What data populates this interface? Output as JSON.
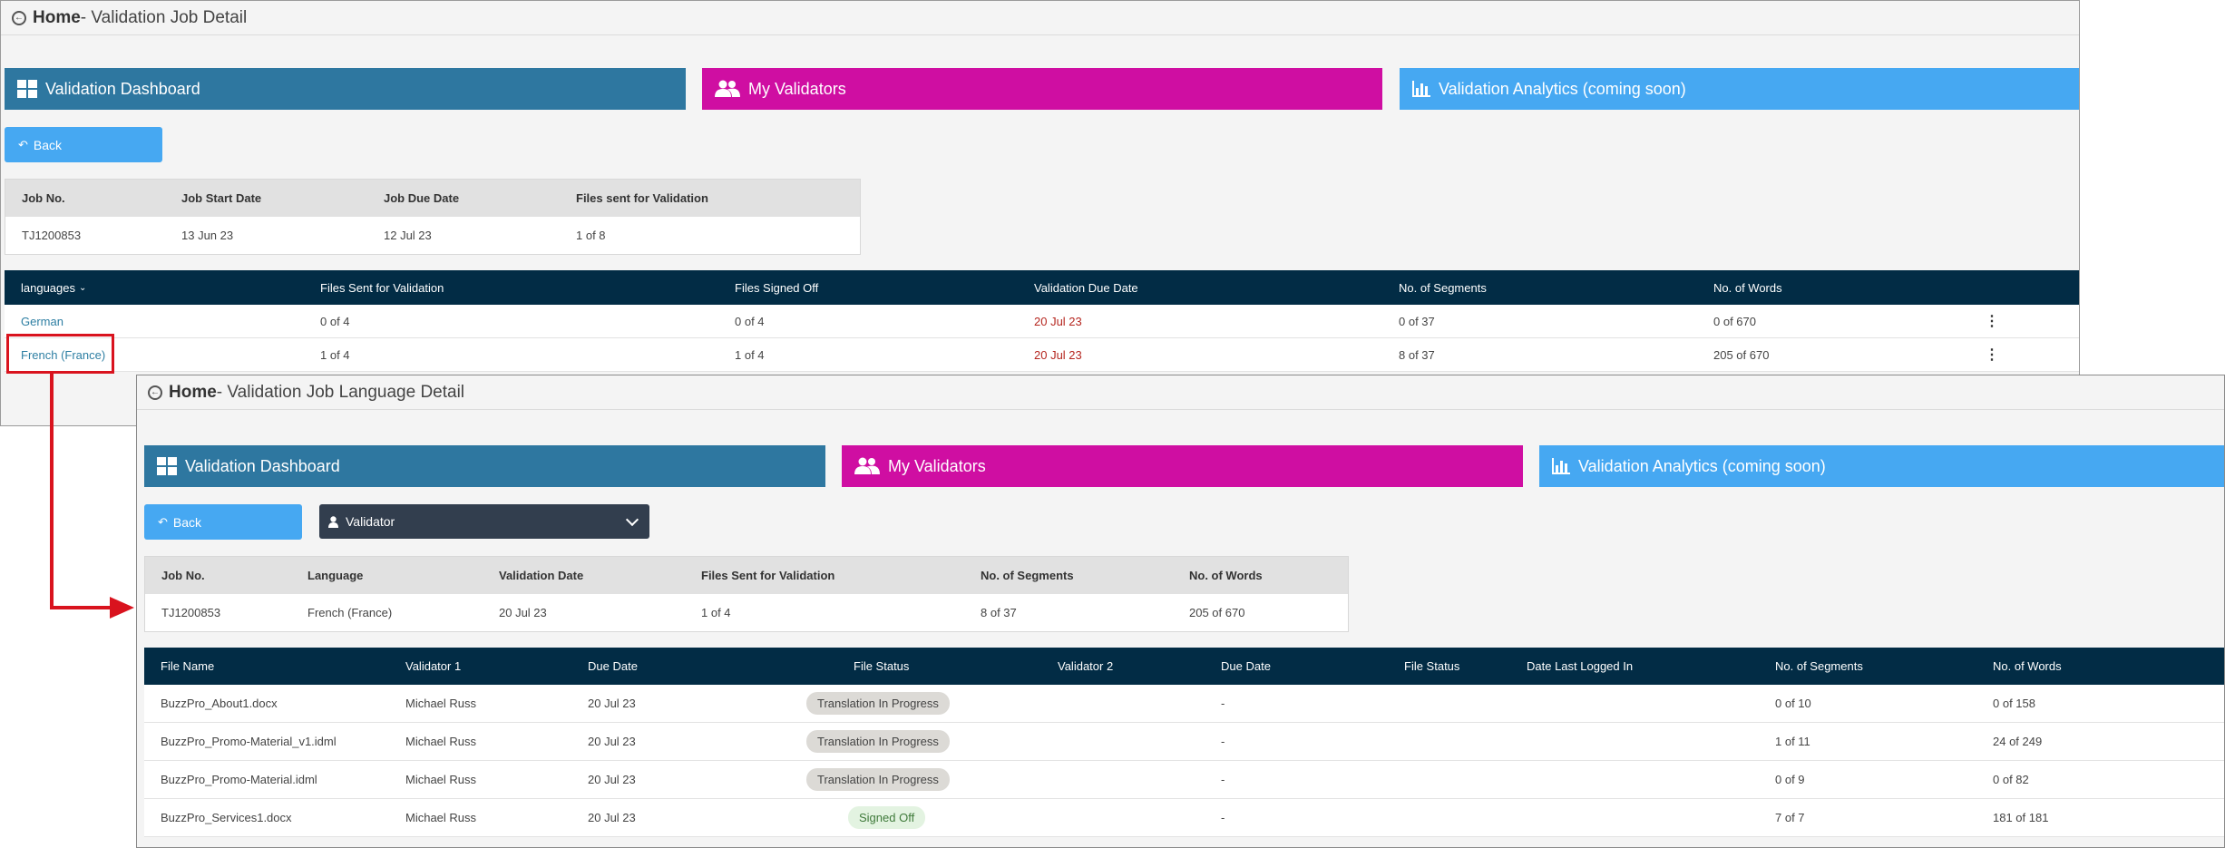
{
  "top_page": {
    "breadcrumb": {
      "home": "Home",
      "title": " - Validation Job Detail"
    },
    "nav": {
      "dashboard": "Validation Dashboard",
      "validators": "My Validators",
      "analytics": "Validation Analytics (coming soon)"
    },
    "back_label": "Back",
    "job_table": {
      "headers": [
        "Job No.",
        "Job Start Date",
        "Job Due Date",
        "Files sent for Validation"
      ],
      "row": [
        "TJ1200853",
        "13 Jun 23",
        "12 Jul 23",
        "1 of 8"
      ]
    },
    "languages_table": {
      "headers": [
        "languages",
        "Files Sent for Validation",
        "Files Signed Off",
        "Validation Due Date",
        "No. of Segments",
        "No. of Words"
      ],
      "rows": [
        [
          "German",
          "0 of 4",
          "0 of 4",
          "20 Jul 23",
          "0 of 37",
          "0 of 670"
        ],
        [
          "French (France)",
          "1 of 4",
          "1 of 4",
          "20 Jul 23",
          "8 of 37",
          "205 of 670"
        ]
      ]
    }
  },
  "detail_page": {
    "breadcrumb": {
      "home": "Home",
      "title": " - Validation Job Language Detail"
    },
    "nav": {
      "dashboard": "Validation Dashboard",
      "validators": "My Validators",
      "analytics": "Validation Analytics (coming soon)"
    },
    "back_label": "Back",
    "validator_select": "Validator",
    "summary_table": {
      "headers": [
        "Job No.",
        "Language",
        "Validation Date",
        "Files Sent for Validation",
        "No. of Segments",
        "No. of Words"
      ],
      "row": [
        "TJ1200853",
        "French (France)",
        "20 Jul 23",
        "1 of 4",
        "8 of 37",
        "205 of 670"
      ]
    },
    "files_table": {
      "headers": [
        "File Name",
        "Validator 1",
        "Due Date",
        "File Status",
        "Validator 2",
        "Due Date",
        "File Status",
        "Date Last Logged In",
        "No. of Segments",
        "No. of Words"
      ],
      "rows": [
        [
          "BuzzPro_About1.docx",
          "Michael Russ",
          "20 Jul 23",
          "Translation In Progress",
          "",
          "-",
          "",
          "",
          "0 of 10",
          "0 of 158"
        ],
        [
          "BuzzPro_Promo-Material_v1.idml",
          "Michael Russ",
          "20 Jul 23",
          "Translation In Progress",
          "",
          "-",
          "",
          "",
          "1 of 11",
          "24 of 249"
        ],
        [
          "BuzzPro_Promo-Material.idml",
          "Michael Russ",
          "20 Jul 23",
          "Translation In Progress",
          "",
          "-",
          "",
          "",
          "0 of 9",
          "0 of 82"
        ],
        [
          "BuzzPro_Services1.docx",
          "Michael Russ",
          "20 Jul 23",
          "Signed Off",
          "",
          "-",
          "",
          "",
          "7 of 7",
          "181 of 181"
        ]
      ]
    }
  },
  "colors": {
    "dashboard_tile": "#2e77a0",
    "validators_tile": "#cf0ea2",
    "analytics_tile": "#46a8f2",
    "table_header": "#022c45",
    "annotation_red": "#d9131e"
  }
}
